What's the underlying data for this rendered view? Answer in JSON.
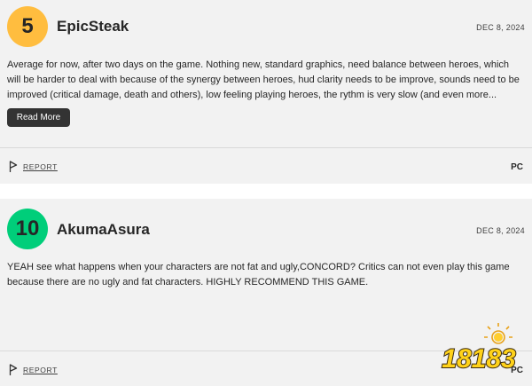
{
  "reviews": [
    {
      "score": "5",
      "score_color": "#ffbd3f",
      "username": "EpicSteak",
      "date": "DEC 8, 2024",
      "text": "Average for now, after two days on the game. Nothing new, standard graphics, need balance between heroes, which will be harder to deal with because of the synergy between heroes, hud clarity needs to be improve, sounds need to be improved (critical damage, death and others), low feeling playing heroes, the rythm is very slow (and even more...",
      "read_more_label": "Read More",
      "report_label": "REPORT",
      "platform": "PC"
    },
    {
      "score": "10",
      "score_color": "#00ce7a",
      "username": "AkumaAsura",
      "date": "DEC 8, 2024",
      "text": "YEAH see what happens when your characters are not fat and ugly,CONCORD? Critics can not even play this game because there are no ugly and fat characters. HIGHLY RECOMMEND THIS GAME.",
      "report_label": "REPORT",
      "platform": "PC"
    }
  ],
  "watermark": {
    "text": "18183",
    "icon": "site-logo-watermark"
  },
  "icons": {
    "report": "flag-icon"
  }
}
